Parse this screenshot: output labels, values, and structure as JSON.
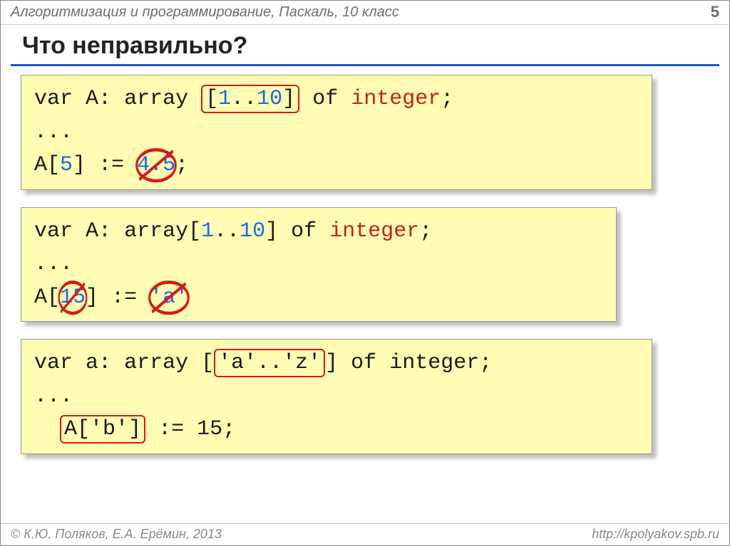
{
  "header": {
    "subject": "Алгоритмизация и программирование, Паскаль, 10 класс",
    "page": "5"
  },
  "title": "Что неправильно?",
  "blocks": [
    {
      "decl": {
        "var": "var",
        "name": "A",
        "array": "array",
        "lbr": "[",
        "lo": "1",
        "dots": "..",
        "hi": "10",
        "rbr": "]",
        "of": "of",
        "type": "integer",
        "semi": ";"
      },
      "ellipsis": "...",
      "assign": {
        "arr": "A",
        "lbr": "[",
        "idx": "5",
        "rbr": "]",
        "op": " := ",
        "rhs": "4.5",
        "after": ";"
      },
      "errors": {
        "strike_rhs": true,
        "box_range": true
      }
    },
    {
      "decl": {
        "var": "var",
        "name": "A",
        "array": "array",
        "lbr": "[",
        "lo": "1",
        "dots": "..",
        "hi": "10",
        "rbr": "]",
        "of": "of",
        "type": "integer",
        "semi": ";"
      },
      "ellipsis": "...",
      "assign": {
        "arr": "A",
        "lbr": "[",
        "idx": "15",
        "rbr": "]",
        "op": " := ",
        "rhs": "'a'",
        "after": ""
      },
      "errors": {
        "strike_idx": true,
        "strike_rhs": true
      }
    },
    {
      "decl": {
        "var": "var",
        "name": "a",
        "array": "array",
        "lbr_sp": " [",
        "lo": "'a'",
        "dots": "..",
        "hi": "'z'",
        "rbr": "]",
        "of": "of",
        "type_plain": "integer",
        "semi": ";"
      },
      "ellipsis": "...",
      "assign": {
        "indent": "  ",
        "arr": "A",
        "lbr": "[",
        "idx": "'b'",
        "rbr": "]",
        "op": " := ",
        "rhs_plain": "15",
        "after": ";"
      },
      "errors": {
        "box_range": true,
        "box_index_expr": true
      }
    }
  ],
  "footer": {
    "copyright": "© К.Ю. Поляков, Е.А. Ерёмин, 2013",
    "url": "http://kpolyakov.spb.ru"
  }
}
